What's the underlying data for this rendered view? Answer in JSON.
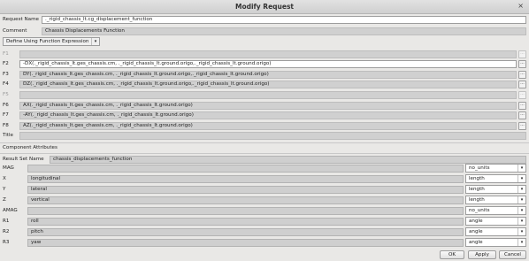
{
  "window": {
    "title": "Modify Request",
    "close_glyph": "×"
  },
  "request_name": {
    "label": "Request Name",
    "value": "._rigid_chassis_lt.cg_displacement_function"
  },
  "comment": {
    "label": "Comment",
    "value": "Chassis Displacements Function"
  },
  "definition_mode": {
    "selected": "Define Using Function Expression"
  },
  "function_rows": [
    {
      "label": "F1",
      "value": "",
      "enabled": false
    },
    {
      "label": "F2",
      "value": "-DX(._rigid_chassis_lt.ges_chassis.cm, ._rigid_chassis_lt.ground.origo,._rigid_chassis_lt.ground.origo)",
      "enabled": true
    },
    {
      "label": "F3",
      "value": "DY(._rigid_chassis_lt.ges_chassis.cm, ._rigid_chassis_lt.ground.origo,._rigid_chassis_lt.ground.origo)",
      "enabled": true
    },
    {
      "label": "F4",
      "value": "DZ(._rigid_chassis_lt.ges_chassis.cm, ._rigid_chassis_lt.ground.origo,._rigid_chassis_lt.ground.origo)",
      "enabled": true
    },
    {
      "label": "F5",
      "value": "",
      "enabled": false
    },
    {
      "label": "F6",
      "value": "AX(._rigid_chassis_lt.ges_chassis.cm, ._rigid_chassis_lt.ground.origo)",
      "enabled": true
    },
    {
      "label": "F7",
      "value": "-AY(._rigid_chassis_lt.ges_chassis.cm, ._rigid_chassis_lt.ground.origo)",
      "enabled": true
    },
    {
      "label": "F8",
      "value": "AZ(._rigid_chassis_lt.ges_chassis.cm, ._rigid_chassis_lt.ground.origo)",
      "enabled": true
    }
  ],
  "ellipsis": "...",
  "title_row": {
    "label": "Title",
    "value": ""
  },
  "component_attributes": {
    "heading": "Component Attributes",
    "result_set_label": "Result Set Name",
    "result_set_value": "chassis_displacements_function"
  },
  "components": [
    {
      "label": "MAG",
      "name": "",
      "units": "no_units"
    },
    {
      "label": "X",
      "name": "longitudinal",
      "units": "length"
    },
    {
      "label": "Y",
      "name": "lateral",
      "units": "length"
    },
    {
      "label": "Z",
      "name": "vertical",
      "units": "length"
    },
    {
      "label": "AMAG",
      "name": "",
      "units": "no_units"
    },
    {
      "label": "R1",
      "name": "roll",
      "units": "angle"
    },
    {
      "label": "R2",
      "name": "pitch",
      "units": "angle"
    },
    {
      "label": "R3",
      "name": "yaw",
      "units": "angle"
    }
  ],
  "buttons": {
    "ok": "OK",
    "apply": "Apply",
    "cancel": "Cancel"
  }
}
